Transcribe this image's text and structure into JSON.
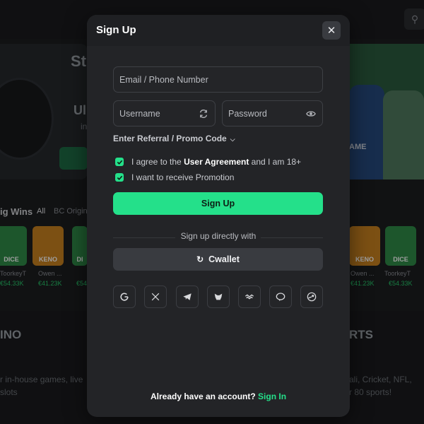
{
  "background": {
    "banner_left_title": "St",
    "banner_left_line2": "Ul",
    "banner_left_line3": "in",
    "shirt_text": "AME",
    "section_title": "ig Wins",
    "tabs": [
      "All",
      "BC Origin"
    ],
    "cards_left": [
      {
        "game": "DICE",
        "user": "ToorkeyT",
        "amount": "€54.33K"
      },
      {
        "game": "KENO",
        "user": "Owen ...",
        "amount": "€41.23K"
      },
      {
        "game": "DI",
        "user": "",
        "amount": "€54"
      }
    ],
    "cards_right": [
      {
        "game": "KENO",
        "user": "Owen ...",
        "amount": "€41.23K"
      },
      {
        "game": "DICE",
        "user": "ToorkeyT",
        "amount": "€54.33K"
      }
    ],
    "casino_title": "INO",
    "sports_title": "RTS",
    "casino_line1": "r in-house games, live",
    "casino_line2": "slots",
    "sports_line1": "ali, Cricket, NFL,",
    "sports_line2": "r 80 sports!"
  },
  "modal": {
    "title": "Sign Up",
    "close_icon": "close-icon",
    "email_placeholder": "Email / Phone Number",
    "username_placeholder": "Username",
    "password_placeholder": "Password",
    "referral_label": "Enter Referral / Promo Code",
    "agree_prefix": "I agree to the ",
    "agree_link": "User Agreement",
    "agree_suffix": " and I am 18+",
    "promo_label": "I want to receive Promotion",
    "signup_button": "Sign Up",
    "divider_text": "Sign up directly with",
    "cwallet_button": "Cwallet",
    "footer_text": "Already have an account?",
    "footer_link": "Sign In"
  },
  "socials": [
    "google",
    "x",
    "telegram",
    "metamask",
    "wallet",
    "line",
    "steam"
  ],
  "colors": {
    "accent": "#24e08a",
    "modal_bg": "#232427",
    "page_bg": "#141517"
  }
}
